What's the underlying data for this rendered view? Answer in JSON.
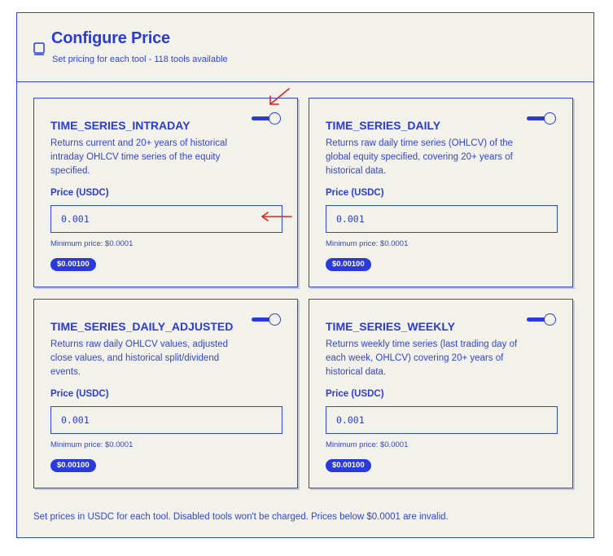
{
  "header": {
    "title": "Configure Price",
    "subtitle": "Set pricing for each tool - 118 tools available",
    "icon": "book-icon"
  },
  "cards": [
    {
      "title": "TIME_SERIES_INTRADAY",
      "description": "Returns current and 20+ years of historical intraday OHLCV time series of the equity specified.",
      "price_label": "Price (USDC)",
      "price_value": "0.001",
      "min_price": "Minimum price: $0.0001",
      "badge": "$0.00100",
      "enabled": true
    },
    {
      "title": "TIME_SERIES_DAILY",
      "description": "Returns raw daily time series (OHLCV) of the global equity specified, covering 20+ years of historical data.",
      "price_label": "Price (USDC)",
      "price_value": "0.001",
      "min_price": "Minimum price: $0.0001",
      "badge": "$0.00100",
      "enabled": true
    },
    {
      "title": "TIME_SERIES_DAILY_ADJUSTED",
      "description": "Returns raw daily OHLCV values, adjusted close values, and historical split/dividend events.",
      "price_label": "Price (USDC)",
      "price_value": "0.001",
      "min_price": "Minimum price: $0.0001",
      "badge": "$0.00100",
      "enabled": true
    },
    {
      "title": "TIME_SERIES_WEEKLY",
      "description": "Returns weekly time series (last trading day of each week, OHLCV) covering 20+ years of historical data.",
      "price_label": "Price (USDC)",
      "price_value": "0.001",
      "min_price": "Minimum price: $0.0001",
      "badge": "$0.00100",
      "enabled": true
    }
  ],
  "footer": {
    "note": "Set prices in USDC for each tool. Disabled tools won't be charged. Prices below $0.0001 are invalid."
  },
  "colors": {
    "accent": "#2b3bd9",
    "background": "#f2f2ea",
    "annotation": "#e02020"
  }
}
